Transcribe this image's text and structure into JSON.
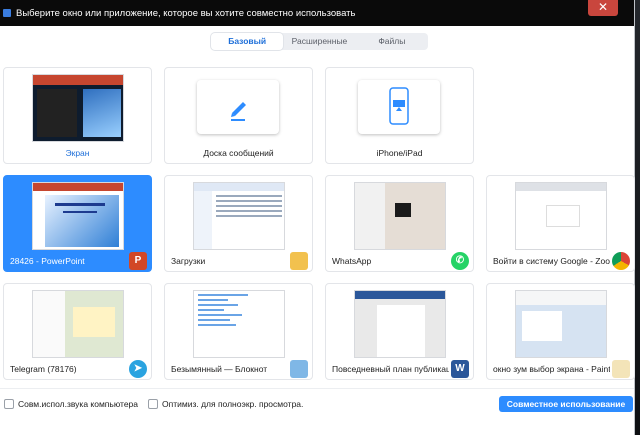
{
  "window": {
    "title": "Выберите окно или приложение, которое вы хотите совместно использовать",
    "close_glyph": "✕"
  },
  "tabs": [
    {
      "label": "Базовый",
      "active": true
    },
    {
      "label": "Расширенные",
      "active": false
    },
    {
      "label": "Файлы",
      "active": false
    }
  ],
  "cards": [
    {
      "label": "Экран",
      "selected": false
    },
    {
      "label": "Доска сообщений",
      "selected": false
    },
    {
      "label": "iPhone/iPad",
      "selected": false
    },
    {
      "label": "28426 - PowerPoint",
      "selected": true,
      "icon": "powerpoint-icon"
    },
    {
      "label": "Загрузки",
      "selected": false,
      "icon": "folder-icon"
    },
    {
      "label": "WhatsApp",
      "selected": false,
      "icon": "whatsapp-icon"
    },
    {
      "label": "Войти в систему Google - Zoom...",
      "selected": false,
      "icon": "chrome-icon"
    },
    {
      "label": "Telegram (78176)",
      "selected": false,
      "icon": "telegram-icon"
    },
    {
      "label": "Безымянный — Блокнот",
      "selected": false,
      "icon": "notepad-icon"
    },
    {
      "label": "Повседневный план публикаци...",
      "selected": false,
      "icon": "word-icon"
    },
    {
      "label": "окно зум выбор экрана - Paint",
      "selected": false,
      "icon": "paint-icon"
    }
  ],
  "footer": {
    "share_sound_label": "Совм.испол.звука компьютера",
    "optimize_label": "Оптимиз. для полноэкр. просмотра.",
    "share_button": "Совместное использование"
  },
  "colors": {
    "accent": "#2d8cff",
    "link": "#1e6fd9"
  }
}
